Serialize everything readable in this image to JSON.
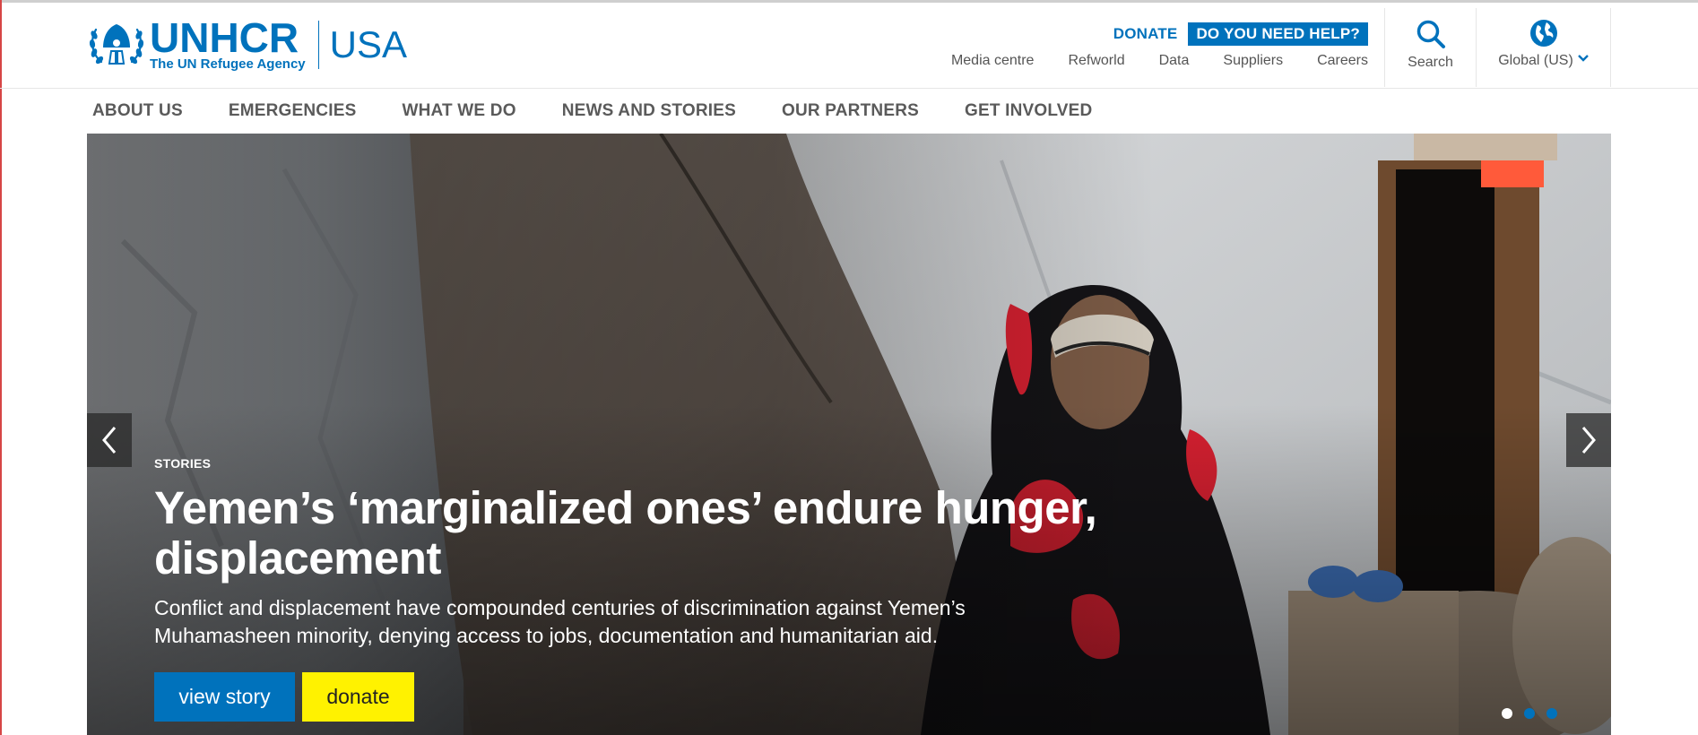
{
  "header": {
    "logo": {
      "wordmark": "UNHCR",
      "tagline": "The UN Refugee Agency",
      "country": "USA"
    },
    "donate_label": "DONATE",
    "help_label": "DO YOU NEED HELP?",
    "utility_nav": [
      "Media centre",
      "Refworld",
      "Data",
      "Suppliers",
      "Careers"
    ],
    "search_label": "Search",
    "region_label": "Global (US)"
  },
  "main_nav": [
    "ABOUT US",
    "EMERGENCIES",
    "WHAT WE DO",
    "NEWS AND STORIES",
    "OUR PARTNERS",
    "GET INVOLVED"
  ],
  "hero": {
    "kicker": "STORIES",
    "headline": "Yemen’s ‘marginalized ones’ endure hunger, displacement",
    "dek": "Conflict and displacement have compounded centuries of discrimination against Yemen’s Muhamasheen minority, denying access to jobs, documentation and humanitarian aid.",
    "primary_button": "view story",
    "secondary_button": "donate",
    "slide_count": 3,
    "active_slide": 1
  },
  "colors": {
    "brand_blue": "#0072bc",
    "donate_yellow": "#fff200",
    "nav_gray": "#5a5a5a"
  },
  "icons": {
    "logo": "unhcr-emblem-icon",
    "search": "search-icon",
    "region": "globe-icon",
    "region_toggle": "chevron-down-icon",
    "prev": "chevron-left-icon",
    "next": "chevron-right-icon"
  }
}
